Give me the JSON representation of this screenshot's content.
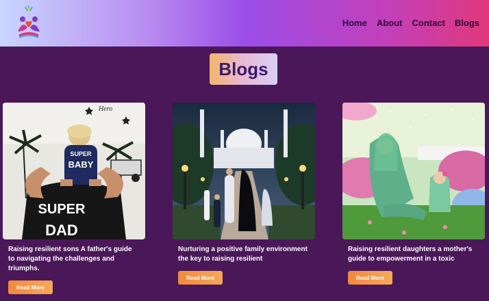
{
  "nav": {
    "links": [
      "Home",
      "About",
      "Contact",
      "Blogs"
    ]
  },
  "heading": "Blogs",
  "cards": [
    {
      "title": "Raising resilient sons A father's guide to navigating the challenges and triumphs.",
      "button": "Read More",
      "image_text": [
        "SUPER",
        "BABY",
        "SUPER",
        "DAD",
        "Hero"
      ]
    },
    {
      "title": "Nurturing a positive family environment the key to raising resilient",
      "button": "Read More"
    },
    {
      "title": "Raising resilient daughters a mother's guide to empowerment in a toxic",
      "button": "Read More"
    }
  ]
}
